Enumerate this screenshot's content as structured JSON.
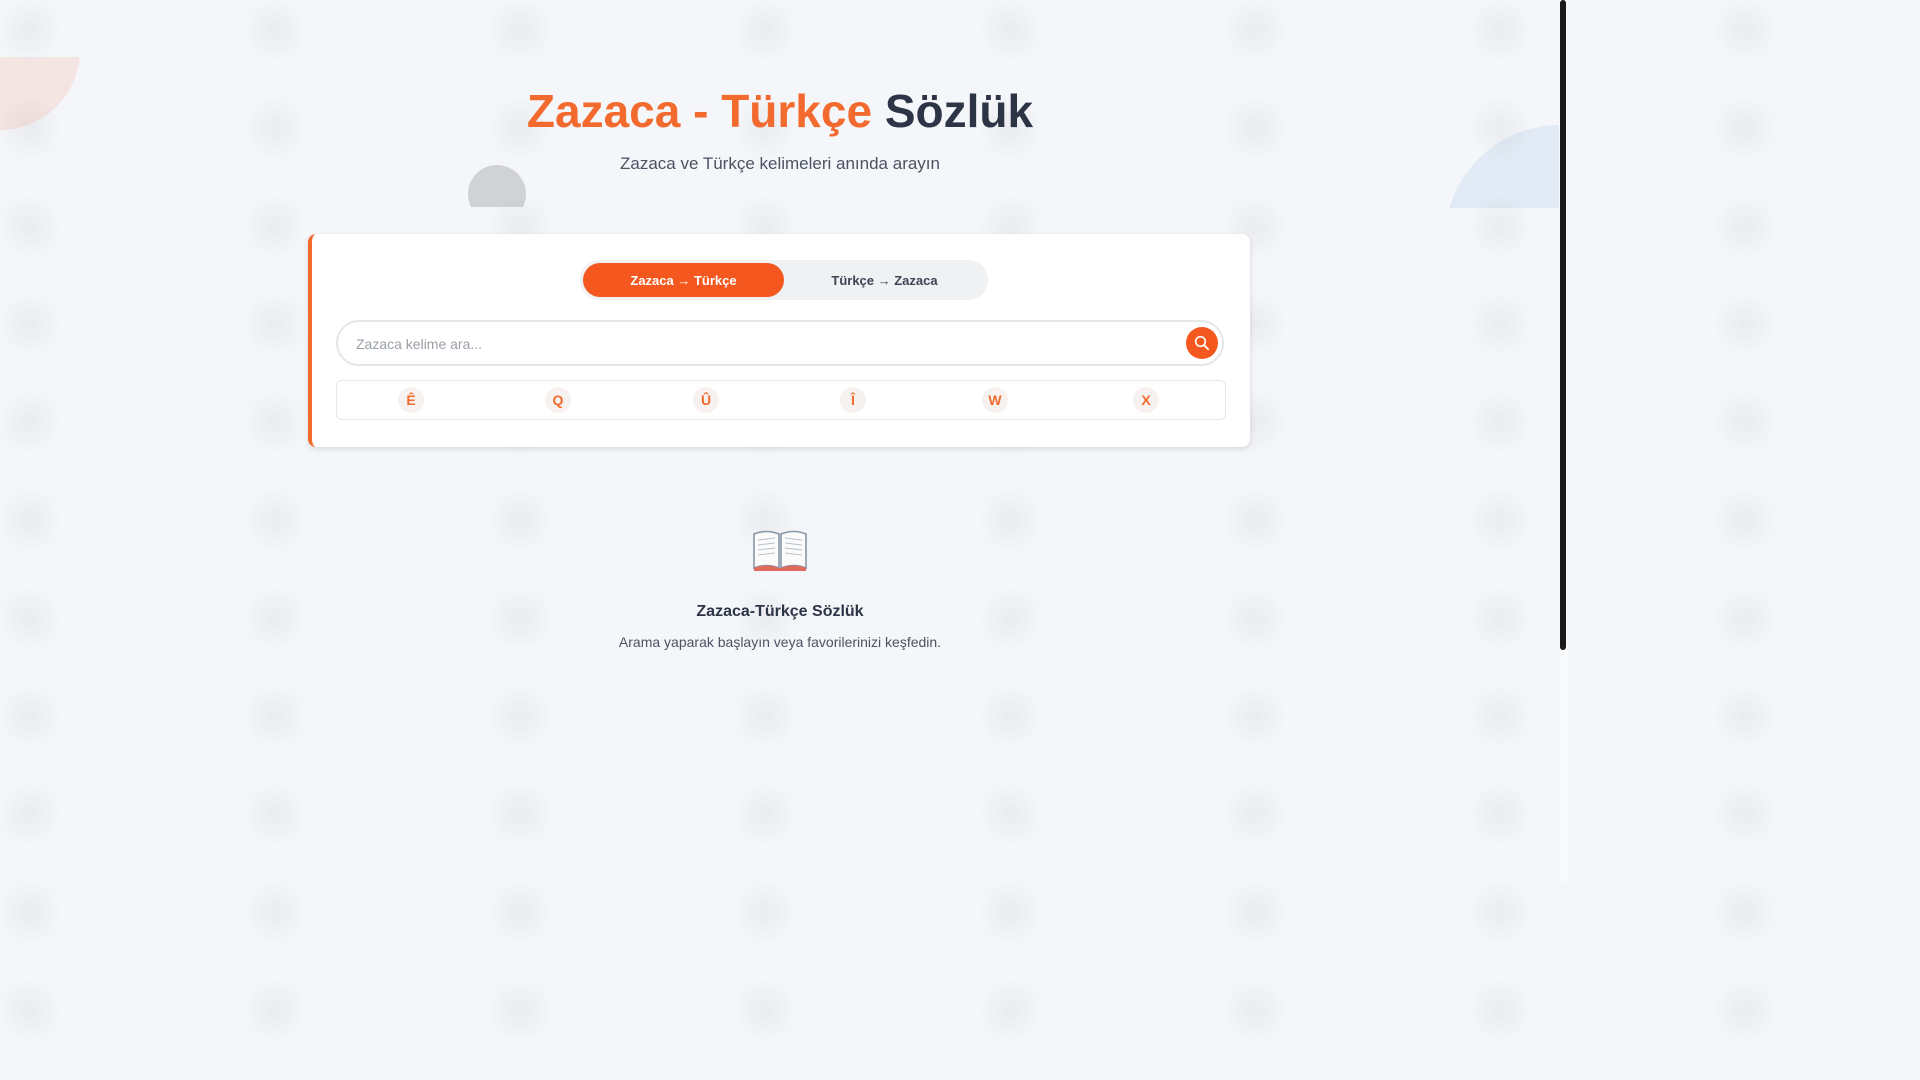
{
  "header": {
    "title_part1": "Zazaca - Türkçe",
    "title_part2": "Sözlük",
    "subtitle": "Zazaca ve Türkçe kelimeleri anında arayın"
  },
  "direction_toggle": {
    "zaza_to_turkish": "Zazaca → Türkçe",
    "turkish_to_zaza": "Türkçe → Zazaca",
    "active": "zaza_to_turkish"
  },
  "search": {
    "placeholder": "Zazaca kelime ara...",
    "value": "",
    "button_icon": "search-icon"
  },
  "special_letters": [
    "Ê",
    "Q",
    "Û",
    "Î",
    "W",
    "X"
  ],
  "empty_state": {
    "icon": "open-book-icon",
    "title": "Zazaca-Türkçe Sözlük",
    "text": "Arama yaparak başlayın veya favorilerinizi keşfedin."
  },
  "colors": {
    "accent": "#f26a2e",
    "button": "#f5581e",
    "dark_text": "#2c3445"
  }
}
